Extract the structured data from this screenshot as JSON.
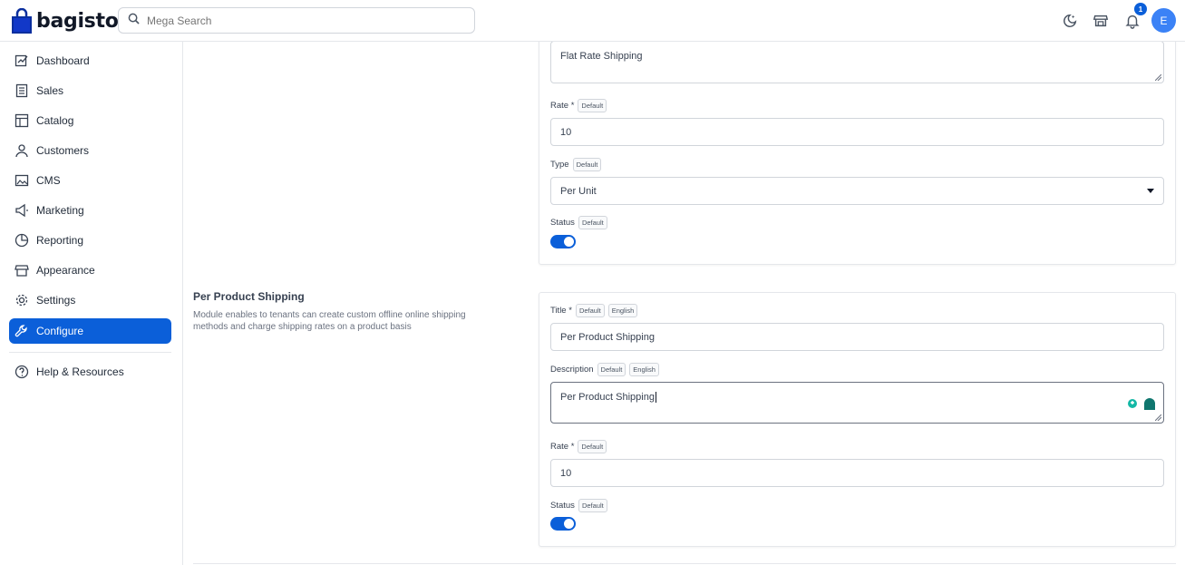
{
  "header": {
    "logo_text": "bagisto",
    "search_placeholder": "Mega Search",
    "notification_count": "1",
    "avatar_initial": "E"
  },
  "sidebar": {
    "items": [
      {
        "label": "Dashboard",
        "icon": "dashboard-icon"
      },
      {
        "label": "Sales",
        "icon": "sales-icon"
      },
      {
        "label": "Catalog",
        "icon": "catalog-icon"
      },
      {
        "label": "Customers",
        "icon": "customers-icon"
      },
      {
        "label": "CMS",
        "icon": "cms-icon"
      },
      {
        "label": "Marketing",
        "icon": "marketing-icon"
      },
      {
        "label": "Reporting",
        "icon": "reporting-icon"
      },
      {
        "label": "Appearance",
        "icon": "appearance-icon"
      },
      {
        "label": "Settings",
        "icon": "settings-icon"
      },
      {
        "label": "Configure",
        "icon": "configure-icon",
        "active": true
      }
    ],
    "help_label": "Help & Resources"
  },
  "flat_rate": {
    "description_value": "Flat Rate Shipping",
    "rate_label": "Rate *",
    "rate_tag": "Default",
    "rate_value": "10",
    "type_label": "Type",
    "type_tag": "Default",
    "type_value": "Per Unit",
    "status_label": "Status",
    "status_tag": "Default",
    "status_enabled": true
  },
  "per_product": {
    "section_title": "Per Product Shipping",
    "section_desc": "Module enables to tenants can create custom offline online shipping methods and charge shipping rates on a product basis",
    "title_label": "Title *",
    "title_tag_1": "Default",
    "title_tag_2": "English",
    "title_value": "Per Product Shipping",
    "description_label": "Description",
    "description_tag_1": "Default",
    "description_tag_2": "English",
    "description_value": "Per Product Shipping",
    "rate_label": "Rate *",
    "rate_tag": "Default",
    "rate_value": "10",
    "status_label": "Status",
    "status_tag": "Default",
    "status_enabled": true
  },
  "colors": {
    "accent": "#0b5fd9"
  }
}
